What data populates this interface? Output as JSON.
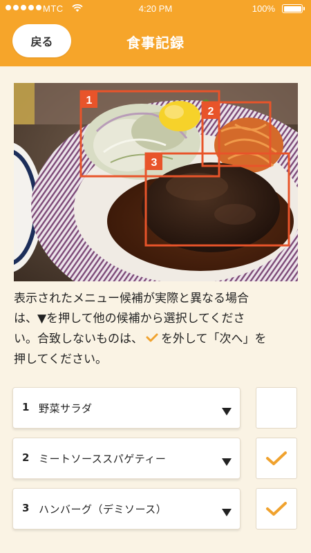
{
  "status_bar": {
    "carrier": "MTC",
    "time": "4:20 PM",
    "battery": "100%",
    "signal_bars": 5
  },
  "header": {
    "back_label": "戻る",
    "title": "食事記録",
    "color": "#f6a52a"
  },
  "photo": {
    "boxes": [
      {
        "number": "1"
      },
      {
        "number": "2"
      },
      {
        "number": "3"
      }
    ],
    "box_color": "#e8542a"
  },
  "instructions": {
    "line1": "表示されたメニュー候補が実際と異なる場合",
    "line2": "は、▼を押して他の候補から選択してくださ",
    "line3a": "い。合致しないものは、",
    "line3b": "を外して「次へ」を",
    "line4": "押してください。"
  },
  "menu_items": [
    {
      "number": "1",
      "label": "野菜サラダ",
      "checked": false
    },
    {
      "number": "2",
      "label": "ミートソーススパゲティー",
      "checked": true
    },
    {
      "number": "3",
      "label": "ハンバーグ（デミソース）",
      "checked": true
    }
  ],
  "colors": {
    "background": "#faf3e4",
    "accent": "#f6a52a",
    "check": "#f0a22e"
  }
}
